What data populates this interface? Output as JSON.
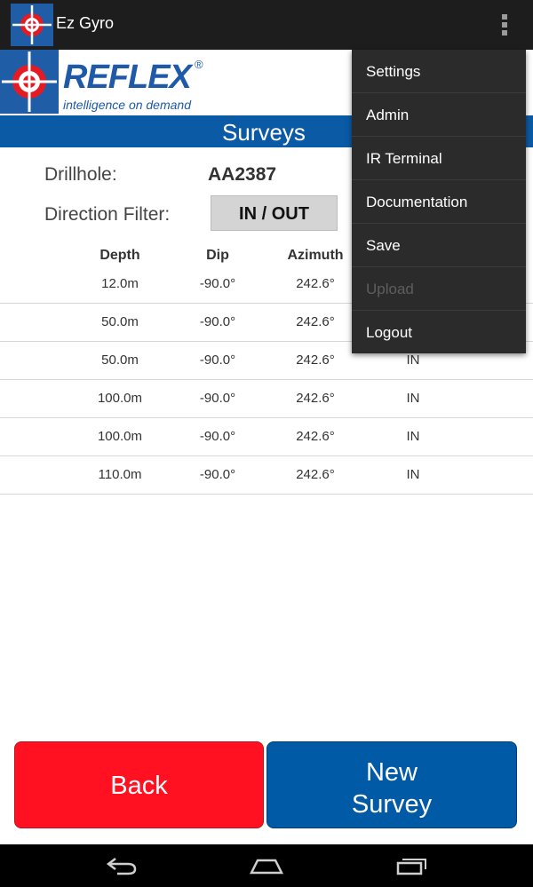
{
  "app": {
    "title": "Ez Gyro",
    "logo_word": "REFLEX",
    "logo_reg": "®",
    "logo_tagline": "intelligence on demand"
  },
  "page": {
    "title": "Surveys"
  },
  "info": {
    "drillhole_label": "Drillhole:",
    "drillhole_value": "AA2387",
    "filter_label": "Direction Filter:",
    "filter_value": "IN / OUT"
  },
  "table": {
    "headers": [
      "Depth",
      "Dip",
      "Azimuth"
    ],
    "rows": [
      {
        "depth": "12.0m",
        "dip": "-90.0°",
        "azimuth": "242.6°",
        "direction": ""
      },
      {
        "depth": "50.0m",
        "dip": "-90.0°",
        "azimuth": "242.6°",
        "direction": ""
      },
      {
        "depth": "50.0m",
        "dip": "-90.0°",
        "azimuth": "242.6°",
        "direction": "IN"
      },
      {
        "depth": "100.0m",
        "dip": "-90.0°",
        "azimuth": "242.6°",
        "direction": "IN"
      },
      {
        "depth": "100.0m",
        "dip": "-90.0°",
        "azimuth": "242.6°",
        "direction": "IN"
      },
      {
        "depth": "110.0m",
        "dip": "-90.0°",
        "azimuth": "242.6°",
        "direction": "IN"
      }
    ]
  },
  "buttons": {
    "back": "Back",
    "new_line1": "New",
    "new_line2": "Survey"
  },
  "menu": {
    "items": [
      {
        "label": "Settings",
        "enabled": true
      },
      {
        "label": "Admin",
        "enabled": true
      },
      {
        "label": "IR Terminal",
        "enabled": true
      },
      {
        "label": "Documentation",
        "enabled": true
      },
      {
        "label": "Save",
        "enabled": true
      },
      {
        "label": "Upload",
        "enabled": false
      },
      {
        "label": "Logout",
        "enabled": true
      }
    ]
  },
  "colors": {
    "brand_blue": "#1e5aa8",
    "title_bar": "#0b5aa6",
    "back_button": "#ff1122",
    "new_survey_button": "#005aa6",
    "action_bar": "#1d1d1d"
  },
  "icons": {
    "app": "crosshair-target-icon",
    "overflow": "overflow-menu-icon",
    "nav_back": "back-icon",
    "nav_home": "home-icon",
    "nav_recents": "recents-icon"
  }
}
